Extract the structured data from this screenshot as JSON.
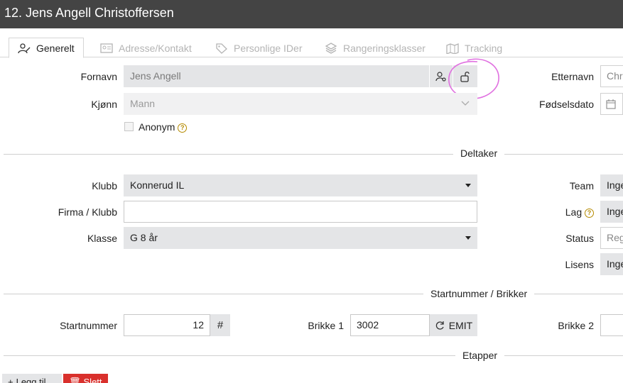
{
  "title": "12. Jens Angell Christoffersen",
  "tabs": [
    {
      "label": "Generelt",
      "icon": "user-edit-icon",
      "active": true
    },
    {
      "label": "Adresse/Kontakt",
      "icon": "id-card-icon",
      "active": false
    },
    {
      "label": "Personlige IDer",
      "icon": "tag-icon",
      "active": false
    },
    {
      "label": "Rangeringsklasser",
      "icon": "layers-icon",
      "active": false
    },
    {
      "label": "Tracking",
      "icon": "map-icon",
      "active": false
    }
  ],
  "person": {
    "fornavn_label": "Fornavn",
    "fornavn_value": "Jens Angell",
    "etternavn_label": "Etternavn",
    "etternavn_value": "Chri",
    "kjonn_label": "Kjønn",
    "kjonn_value": "Mann",
    "fodselsdato_label": "Fødselsdato",
    "anonym_label": "Anonym",
    "help_glyph": "?"
  },
  "deltaker": {
    "section_title": "Deltaker",
    "klubb_label": "Klubb",
    "klubb_value": "Konnerud IL",
    "firma_label": "Firma / Klubb",
    "firma_value": "",
    "klasse_label": "Klasse",
    "klasse_value": "G 8 år",
    "team_label": "Team",
    "team_value": "Inge",
    "lag_label": "Lag",
    "lag_value": "Inge",
    "status_label": "Status",
    "status_value": "Reg",
    "lisens_label": "Lisens",
    "lisens_value": "Inge"
  },
  "startnummer": {
    "section_title": "Startnummer / Brikker",
    "startnummer_label": "Startnummer",
    "startnummer_value": "12",
    "hash_label": "#",
    "brikke1_label": "Brikke 1",
    "brikke1_value": "3002",
    "emit_label": "EMIT",
    "brikke2_label": "Brikke 2"
  },
  "etapper": {
    "section_title": "Etapper"
  },
  "footer": {
    "add_label": "Legg til",
    "delete_label": "Slett"
  },
  "colors": {
    "titlebar": "#444444",
    "field_bg": "#e4e5e7",
    "annotation": "#e070e0",
    "delete": "#d9302c"
  }
}
